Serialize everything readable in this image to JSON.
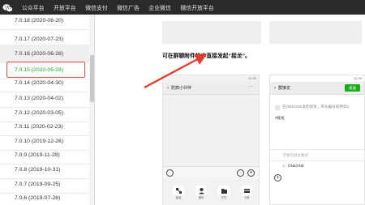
{
  "nav": {
    "links": [
      "公众平台",
      "开放平台",
      "微信支付",
      "微信广告",
      "企业微信",
      "微信开放平台"
    ]
  },
  "versions": [
    "7.0.18 (2020-08-20)",
    "7.0.17 (2020-07-23)",
    "7.0.16 (2020-06-28)",
    "7.0.15 (2020-05-28)",
    "7.0.14 (2020-04-30)",
    "7.0.13 (2020-04-02)",
    "7.0.12 (2020-03-05)",
    "7.0.11 (2020-02-23)",
    "7.0.10 (2019-12-26)",
    "7.0.9 (2019-11-28)",
    "7.0.8 (2019-10-31)",
    "7.0.7 (2019-09-25)",
    "7.0.6 (2019-07-26)"
  ],
  "selected_version_index": 2,
  "highlighted_version_index": 3,
  "main": {
    "instruction": "可在群聊附件栏中直接发起“接龙”。"
  },
  "left_phone": {
    "time": "12:30",
    "title": "防弊小伙伴",
    "tools": [
      "接龙",
      "通讯",
      "文件",
      "卡券"
    ]
  },
  "right_phone": {
    "time": "12:30",
    "title": "群接龙",
    "done_label": "发送",
    "desc": "在ONEONE发起接龙，带头编号如例如1",
    "tag": "#接龙",
    "placeholder1": "可填写接龙格式",
    "entry1": "1.",
    "entry2": "ONEONE"
  },
  "colors": {
    "accent_green": "#1aad19",
    "highlight_red": "#d9534f",
    "nav_bg": "#2a2a2a",
    "arrow_red": "#e33b2e"
  }
}
